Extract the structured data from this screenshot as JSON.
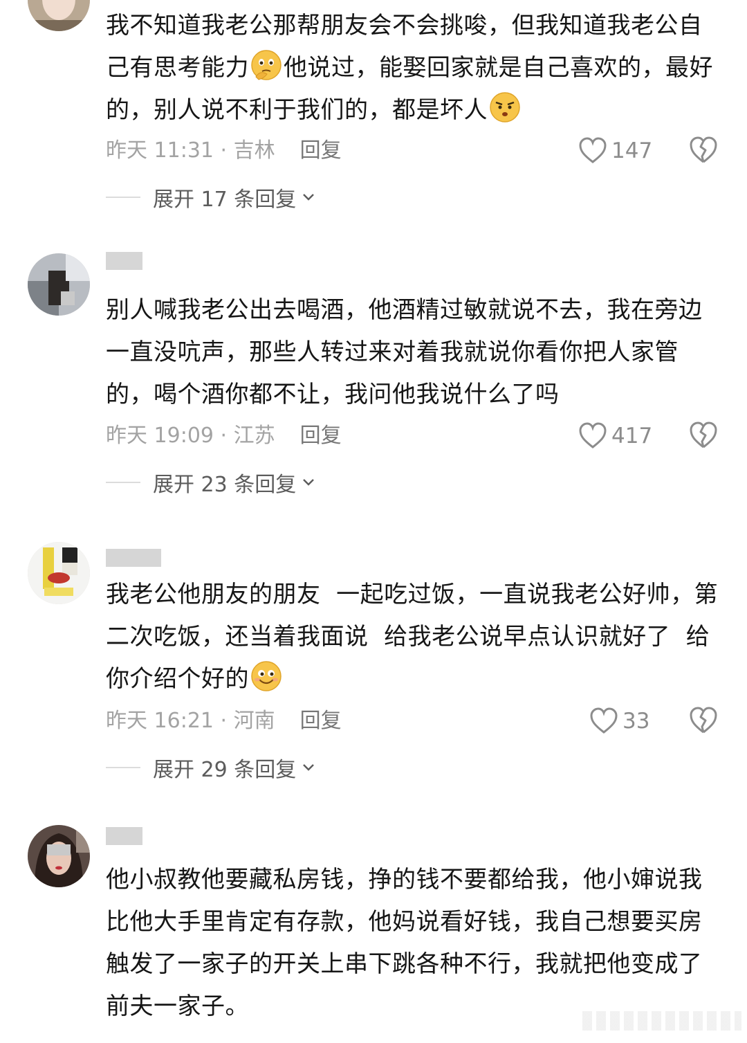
{
  "comments": [
    {
      "text_parts": [
        "我不知道我老公那帮朋友会不会挑唆，但我知道我老公自己有思考能力",
        "他说过，能娶回家就是自己喜欢的，最好的，别人说不利于我们的，都是坏人"
      ],
      "emojis": [
        "thinking-emoji",
        "annoyed-emoji"
      ],
      "time_location": "昨天 11:31 · 吉林",
      "reply_label": "回复",
      "likes": "147",
      "expand_label": "展开 17 条回复"
    },
    {
      "text_parts": [
        "别人喊我老公出去喝酒，他酒精过敏就说不去，我在旁边一直没吭声，那些人转过来对着我就说你看你把人家管的，喝个酒你都不让，我问他我说什么了吗"
      ],
      "emojis": [],
      "time_location": "昨天 19:09 · 江苏",
      "reply_label": "回复",
      "likes": "417",
      "expand_label": "展开 23 条回复"
    },
    {
      "text_parts": [
        "我老公他朋友的朋友  一起吃过饭，一直说我老公好帅，第二次吃饭，还当着我面说  给我老公说早点认识就好了  给你介绍个好的"
      ],
      "emojis": [
        "smile-emoji"
      ],
      "time_location": "昨天 16:21 · 河南",
      "reply_label": "回复",
      "likes": "33",
      "expand_label": "展开 29 条回复"
    },
    {
      "text_parts": [
        "他小叔教他要藏私房钱，挣的钱不要都给我，他小婶说我比他大手里肯定有存款，他妈说看好钱，我自己想要买房触发了一家子的开关上串下跳各种不行，我就把他变成了前夫一家子。"
      ],
      "emojis": []
    }
  ],
  "colors": {
    "text": "#161616",
    "meta": "#a3a3a3",
    "reply": "#777777",
    "expand": "#5c5c5c"
  }
}
